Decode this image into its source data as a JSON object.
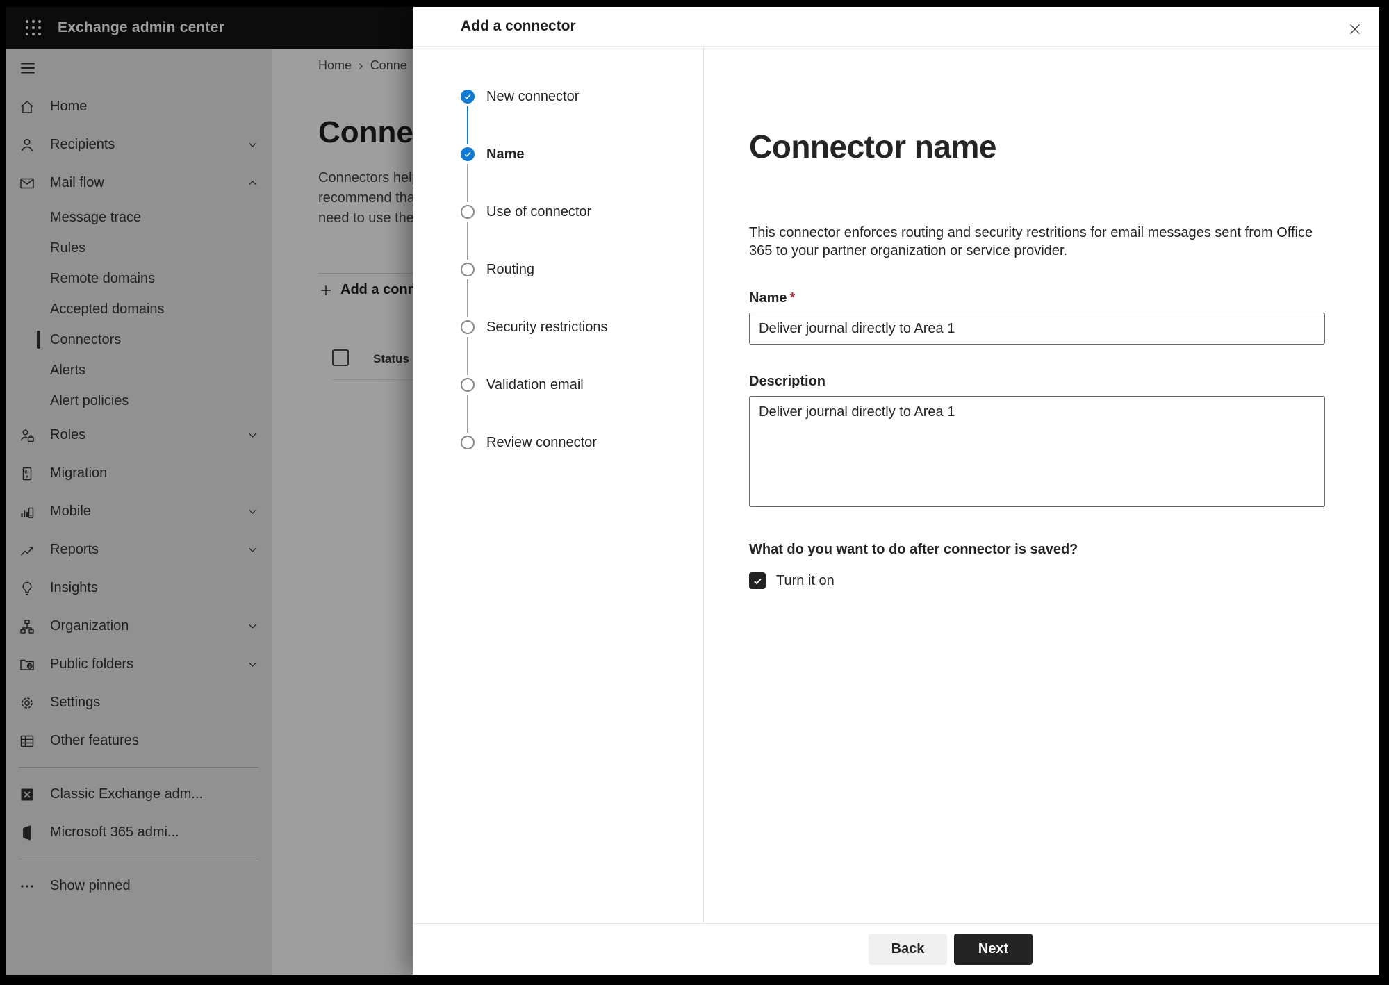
{
  "topbar": {
    "title": "Exchange admin center"
  },
  "sidebar": {
    "items": [
      {
        "type": "top",
        "icon": "home-icon",
        "label": "Home"
      },
      {
        "type": "top",
        "icon": "person-icon",
        "label": "Recipients",
        "chevron": "chevron-down"
      },
      {
        "type": "top",
        "icon": "mail-icon",
        "label": "Mail flow",
        "chevron": "chevron-up"
      },
      {
        "type": "sub",
        "label": "Message trace"
      },
      {
        "type": "sub",
        "label": "Rules"
      },
      {
        "type": "sub",
        "label": "Remote domains"
      },
      {
        "type": "sub",
        "label": "Accepted domains"
      },
      {
        "type": "sub",
        "label": "Connectors",
        "state": "selected"
      },
      {
        "type": "sub",
        "label": "Alerts"
      },
      {
        "type": "sub",
        "label": "Alert policies"
      },
      {
        "type": "top",
        "icon": "roles-icon",
        "label": "Roles",
        "chevron": "chevron-down"
      },
      {
        "type": "top",
        "icon": "migration-icon",
        "label": "Migration"
      },
      {
        "type": "top",
        "icon": "mobile-icon",
        "label": "Mobile",
        "chevron": "chevron-down"
      },
      {
        "type": "top",
        "icon": "reports-icon",
        "label": "Reports",
        "chevron": "chevron-down"
      },
      {
        "type": "top",
        "icon": "insights-icon",
        "label": "Insights"
      },
      {
        "type": "top",
        "icon": "organization-icon",
        "label": "Organization",
        "chevron": "chevron-down"
      },
      {
        "type": "top",
        "icon": "public-folders-icon",
        "label": "Public folders",
        "chevron": "chevron-down"
      },
      {
        "type": "top",
        "icon": "settings-icon",
        "label": "Settings"
      },
      {
        "type": "top",
        "icon": "other-features-icon",
        "label": "Other features"
      },
      {
        "type": "divider"
      },
      {
        "type": "top",
        "icon": "classic-exchange-icon",
        "label": "Classic Exchange adm..."
      },
      {
        "type": "top",
        "icon": "m365-icon",
        "label": "Microsoft 365 admi..."
      },
      {
        "type": "divider"
      },
      {
        "type": "top",
        "icon": "ellipsis-icon",
        "label": "Show pinned"
      }
    ]
  },
  "background_page": {
    "breadcrumb": {
      "home": "Home",
      "separator": "›",
      "current": "Conne"
    },
    "heading": "Connect",
    "intro_lines": [
      "Connectors help",
      "recommend that",
      "need to use ther"
    ],
    "add_button_label": "Add a conn",
    "table": {
      "status_header": "Status"
    }
  },
  "dialog": {
    "title": "Add a connector",
    "steps": [
      {
        "label": "New connector",
        "state": "completed"
      },
      {
        "label": "Name",
        "state": "active",
        "connector": "blue"
      },
      {
        "label": "Use of connector",
        "state": "upcoming",
        "connector": "gray"
      },
      {
        "label": "Routing",
        "state": "upcoming",
        "connector": "gray"
      },
      {
        "label": "Security restrictions",
        "state": "upcoming",
        "connector": "gray"
      },
      {
        "label": "Validation email",
        "state": "upcoming",
        "connector": "gray"
      },
      {
        "label": "Review connector",
        "state": "upcoming",
        "connector": "gray"
      }
    ],
    "page": {
      "heading": "Connector name",
      "description": "This connector enforces routing and security restritions for email messages sent from Office 365 to your partner organization or service provider.",
      "name_label": "Name",
      "required_marker": "*",
      "name_value": "Deliver journal directly to Area 1",
      "description_label": "Description",
      "description_value": "Deliver journal directly to Area 1",
      "after_save_question": "What do you want to do after connector is saved?",
      "turn_it_on_label": "Turn it on",
      "turn_it_on_checked": true
    },
    "footer": {
      "back": "Back",
      "next": "Next"
    }
  },
  "colors": {
    "accent_blue": "#0f7ad6",
    "required_red": "#a4262c",
    "next_button_bg": "#242424",
    "topbar_bg": "#141414",
    "sidebar_bg": "#eaeaea"
  }
}
